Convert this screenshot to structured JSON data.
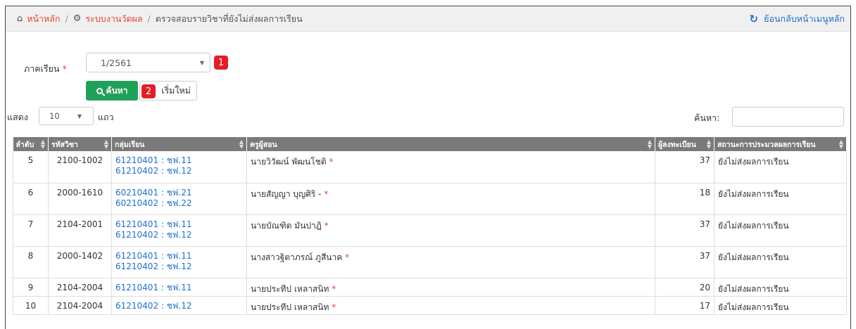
{
  "breadcrumb": {
    "home_icon": "home-icon",
    "home_label": "หน้าหลัก",
    "section_icon": "gear-icon",
    "section_label": "ระบบงานวัดผล",
    "current_label": "ตรวจสอบรายวิชาที่ยังไม่ส่งผลการเรียน",
    "separator": "/",
    "back_icon": "refresh-icon",
    "back_label": "ย้อนกลับหน้าเมนูหลัก"
  },
  "form": {
    "semester_label": "ภาคเรียน",
    "required_mark": "*",
    "semester_value": "1/2561",
    "search_button": "ค้นหา",
    "reset_button": "เริ่มใหม่",
    "step1": "1",
    "step2": "2"
  },
  "table_controls": {
    "show_label": "แสดง",
    "page_size": "10",
    "rows_label": "แถว",
    "search_label": "ค้นหา:",
    "search_value": ""
  },
  "table": {
    "headers": [
      "ลำดับ",
      "รหัสวิชา",
      "กลุ่มเรียน",
      "ครูผู้สอน",
      "ผู้ลงทะเบียน",
      "สถานะการประมวลผลการเรียน"
    ],
    "rows": [
      {
        "no": "5",
        "code": "2100-1002",
        "groups": [
          "61210401 : ชฟ.11",
          "61210402 : ชฟ.12"
        ],
        "teacher": "นายวิวัฒน์ พัฒนโชติ",
        "count": "37",
        "status": "ยังไม่ส่งผลการเรียน"
      },
      {
        "no": "6",
        "code": "2000-1610",
        "groups": [
          "60210401 : ชฟ.21",
          "60210402 : ชฟ.22"
        ],
        "teacher": "นายสัญญา บุญศิริ -",
        "count": "18",
        "status": "ยังไม่ส่งผลการเรียน"
      },
      {
        "no": "7",
        "code": "2104-2001",
        "groups": [
          "61210401 : ชฟ.11",
          "61210402 : ชฟ.12"
        ],
        "teacher": "นายบัณฑิต มันปาฎิ",
        "count": "37",
        "status": "ยังไม่ส่งผลการเรียน"
      },
      {
        "no": "8",
        "code": "2000-1402",
        "groups": [
          "61210401 : ชฟ.11",
          "61210402 : ชฟ.12"
        ],
        "teacher": "นางสาวฐิตาภรณ์ ภูสีนาค",
        "count": "37",
        "status": "ยังไม่ส่งผลการเรียน"
      },
      {
        "no": "9",
        "code": "2104-2004",
        "groups": [
          "61210401 : ชฟ.11"
        ],
        "teacher": "นายประทีป เหลาสนิท",
        "count": "20",
        "status": "ยังไม่ส่งผลการเรียน"
      },
      {
        "no": "10",
        "code": "2104-2004",
        "groups": [
          "61210402 : ชฟ.12"
        ],
        "teacher": "นายประทีป เหลาสนิท",
        "count": "17",
        "status": "ยังไม่ส่งผลการเรียน"
      }
    ]
  },
  "colors": {
    "accent_link": "#e8452c",
    "blue_link": "#1e6fd0",
    "search_button": "#20a15a",
    "badge": "#e41e26",
    "header_bg": "#7a7a7a"
  }
}
